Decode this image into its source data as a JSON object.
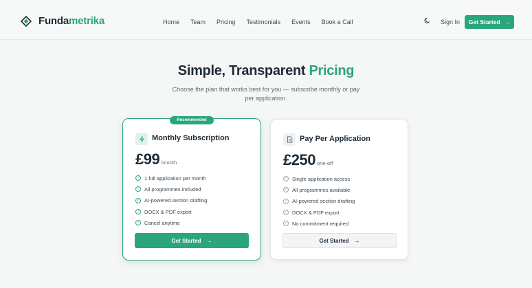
{
  "brand": {
    "name_part1": "Funda",
    "name_part2": "metrika"
  },
  "nav": {
    "items": [
      "Home",
      "Team",
      "Pricing",
      "Testimonials",
      "Events",
      "Book a Call"
    ]
  },
  "header": {
    "sign_in": "Sign In",
    "cta_label": "Get Started",
    "cta_arrow": "→",
    "theme_icon": "moon-icon"
  },
  "hero": {
    "title_part1": "Simple, Transparent ",
    "title_part2": "Pricing",
    "subtitle": "Choose the plan that works best for you — subscribe monthly or pay per application."
  },
  "plans": [
    {
      "badge": "Recommended",
      "icon": "lightning-icon",
      "name": "Monthly Subscription",
      "price": "£99",
      "period": "/month",
      "features": [
        "1 full application per month",
        "All programmes included",
        "AI-powered section drafting",
        "DOCX & PDF export",
        "Cancel anytime"
      ],
      "button": "Get Started",
      "button_arrow": "→"
    },
    {
      "icon": "document-icon",
      "name": "Pay Per Application",
      "price": "£250",
      "period": "one-off",
      "features": [
        "Single application access",
        "All programmes available",
        "AI-powered section drafting",
        "DOCX & PDF export",
        "No commitment required"
      ],
      "button": "Get Started",
      "button_arrow": "→"
    }
  ],
  "colors": {
    "accent": "#2ba57a",
    "text": "#1f2b36",
    "muted": "#5f6b75",
    "background": "#f5f6f6"
  }
}
